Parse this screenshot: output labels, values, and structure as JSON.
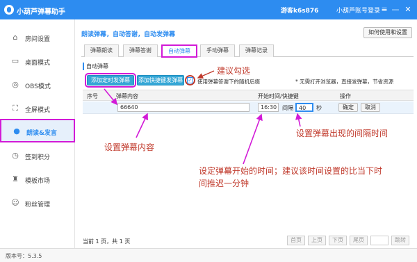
{
  "app": {
    "title": "小葫芦弹幕助手",
    "user": "游客k6s876",
    "login": "小葫芦账号登录",
    "window_buttons": [
      "≡",
      "—",
      "✕"
    ]
  },
  "sidebar": {
    "items": [
      {
        "label": "房间设置",
        "icon": "house-icon",
        "glyph": "⌂"
      },
      {
        "label": "桌面模式",
        "icon": "monitor-icon",
        "glyph": "▭"
      },
      {
        "label": "OBS模式",
        "icon": "obs-icon",
        "glyph": "◎"
      },
      {
        "label": "全屏模式",
        "icon": "fullscreen-icon",
        "glyph": "⛶"
      },
      {
        "label": "朗读&发言",
        "icon": "microphone-icon",
        "glyph": "●",
        "active": true
      },
      {
        "label": "签到积分",
        "icon": "checkin-icon",
        "glyph": "◷"
      },
      {
        "label": "模板市场",
        "icon": "shirt-icon",
        "glyph": "♜"
      },
      {
        "label": "粉丝管理",
        "icon": "fans-icon",
        "glyph": "☺"
      }
    ]
  },
  "main": {
    "breadcrumb": "朗读弹幕，自动答谢，自动发弹幕",
    "help_button": "如何使用和设置",
    "tabs": [
      "弹幕朗读",
      "弹幕答谢",
      "自动弹幕",
      "手动弹幕",
      "弹幕记录"
    ],
    "active_tab": 2,
    "section_label": "自动弹幕",
    "add_timed_button": "添加定时发弹幕",
    "add_hotkey_button": "添加快捷键发弹幕",
    "random_checkbox_label": "使用弹幕答谢下的随机后缀",
    "random_checked": true,
    "tip_right": "* 无需打开浏览器，直接发弹幕，节省资源",
    "table": {
      "headers": [
        "序号",
        "弹幕内容",
        "开始时间/快捷键",
        "操作"
      ],
      "row": {
        "content": "66640",
        "start_time": "16:30",
        "interval_label": "间隔",
        "interval_value": "40",
        "interval_unit": "秒",
        "confirm": "确定",
        "cancel": "取消"
      }
    },
    "footer": {
      "page_info": "当前 1 页，共 1 页",
      "buttons": [
        "首页",
        "上页",
        "下页",
        "尾页",
        "",
        "跳转"
      ]
    }
  },
  "annotations": {
    "suggest_check": "建议勾选",
    "set_content": "设置弹幕内容",
    "set_interval": "设置弹幕出现的间隔时间",
    "set_start_line1": "设定弹幕开始的时间；建议该时间设置的比当下时",
    "set_start_line2": "间推迟一分钟"
  },
  "version": "版本号：5.3.5",
  "colors": {
    "titlebar": "#2d8cf0",
    "highlight": "#d21ad7",
    "annotation": "#c0392b",
    "action_button": "#35a7d6"
  }
}
